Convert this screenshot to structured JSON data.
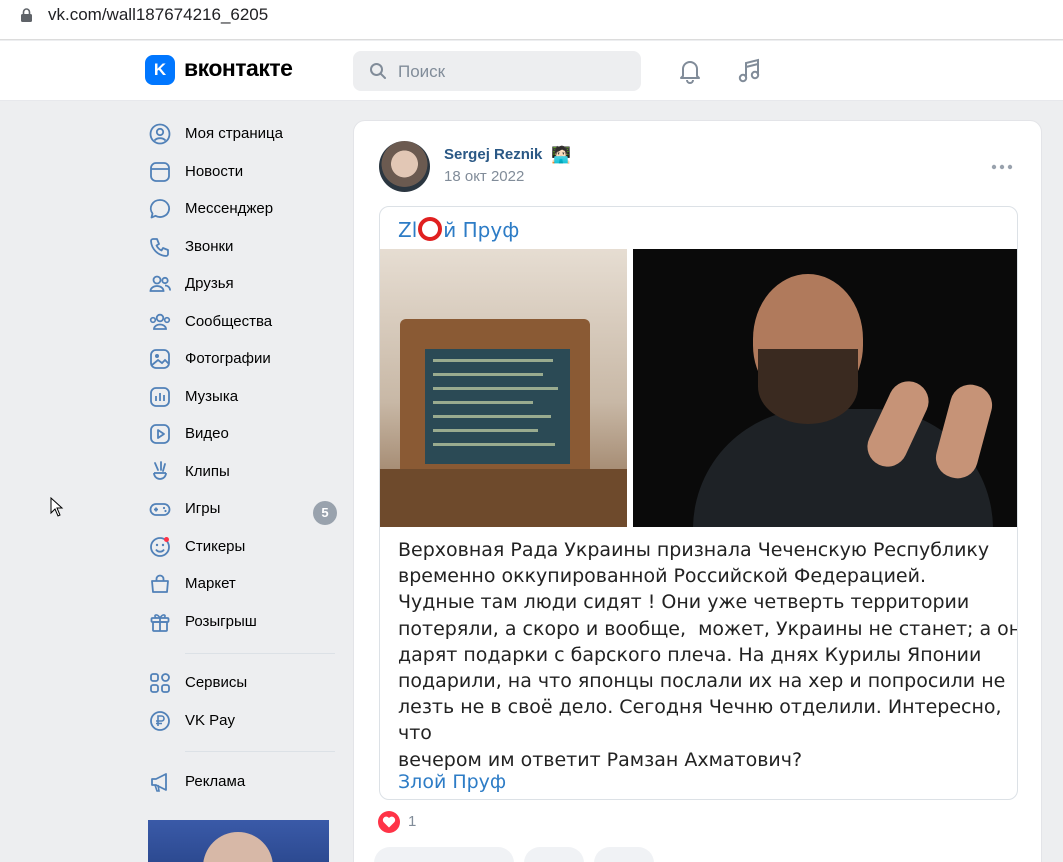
{
  "browser": {
    "url": "vk.com/wall187674216_6205"
  },
  "header": {
    "logo_letter": "K",
    "brand": "вконтакте",
    "search_placeholder": "Поиск"
  },
  "menu": {
    "items": [
      {
        "label": "Моя страница",
        "icon": "user-circle-icon"
      },
      {
        "label": "Новости",
        "icon": "newsfeed-icon"
      },
      {
        "label": "Мессенджер",
        "icon": "message-icon"
      },
      {
        "label": "Звонки",
        "icon": "phone-icon"
      },
      {
        "label": "Друзья",
        "icon": "friends-icon"
      },
      {
        "label": "Сообщества",
        "icon": "communities-icon"
      },
      {
        "label": "Фотографии",
        "icon": "photo-icon"
      },
      {
        "label": "Музыка",
        "icon": "music-icon"
      },
      {
        "label": "Видео",
        "icon": "video-icon"
      },
      {
        "label": "Клипы",
        "icon": "clips-icon"
      },
      {
        "label": "Игры",
        "icon": "games-icon",
        "badge": "5"
      },
      {
        "label": "Стикеры",
        "icon": "stickers-icon"
      },
      {
        "label": "Маркет",
        "icon": "market-icon"
      },
      {
        "label": "Розыгрыш",
        "icon": "gift-icon"
      }
    ],
    "services": [
      {
        "label": "Сервисы",
        "icon": "services-icon"
      },
      {
        "label": "VK Pay",
        "icon": "vkpay-icon"
      }
    ],
    "ads": {
      "label": "Реклама",
      "icon": "megaphone-icon"
    }
  },
  "post": {
    "author": "Sergej Reznik",
    "author_emoji": "🧑🏻‍💻",
    "date": "18 окт 2022",
    "repost": {
      "source_title_left": "Zl",
      "source_title_right": "й Пруф",
      "text_lines": [
        "Верховная Рада Украины признала Чеченскую Республику",
        "временно оккупированной Российской Федерацией.",
        "Чудные там люди сидят ! Они уже четверть территории",
        "потеряли, а скоро и вообще,  может, Украины не станет; а они",
        "дарят подарки с барского плеча. На днях Курилы Японии",
        "подарили, на что японцы послали их на хер и попросили не",
        "лезть не в своё дело. Сегодня Чечню отделили. Интересно, что",
        "вечером им ответит Рамзан Ахматович?"
      ],
      "footer": "Злой Пруф"
    },
    "likes": "1"
  },
  "colors": {
    "accent": "#0077ff",
    "link": "#2a5885",
    "repost_link": "#2d7cc6",
    "like": "#ff3347"
  }
}
